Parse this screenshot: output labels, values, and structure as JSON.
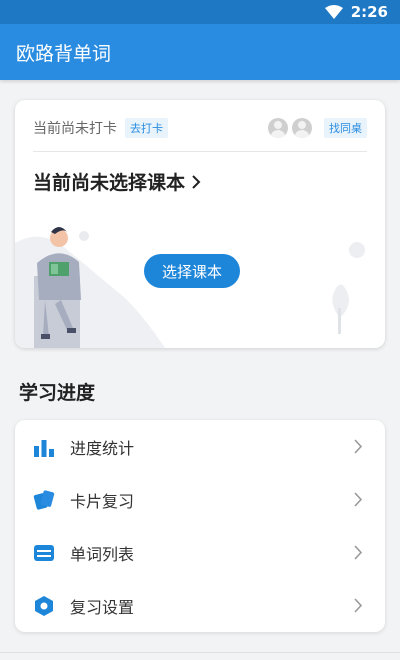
{
  "status_bar": {
    "time": "2:26"
  },
  "app_bar": {
    "title": "欧路背单词"
  },
  "checkin_card": {
    "status": "当前尚未打卡",
    "checkin_tag": "去打卡",
    "partner_tag": "找同桌",
    "no_course": "当前尚未选择课本",
    "select_button": "选择课本"
  },
  "progress_section": {
    "title": "学习进度",
    "items": [
      {
        "label": "进度统计",
        "icon": "bar-chart-icon"
      },
      {
        "label": "卡片复习",
        "icon": "cards-icon"
      },
      {
        "label": "单词列表",
        "icon": "list-icon"
      },
      {
        "label": "复习设置",
        "icon": "hexagon-settings-icon"
      }
    ]
  },
  "colors": {
    "status_bar": "#1f78c4",
    "app_bar": "#2a8ce0",
    "accent": "#1e86d9",
    "background": "#f2f3f5"
  }
}
